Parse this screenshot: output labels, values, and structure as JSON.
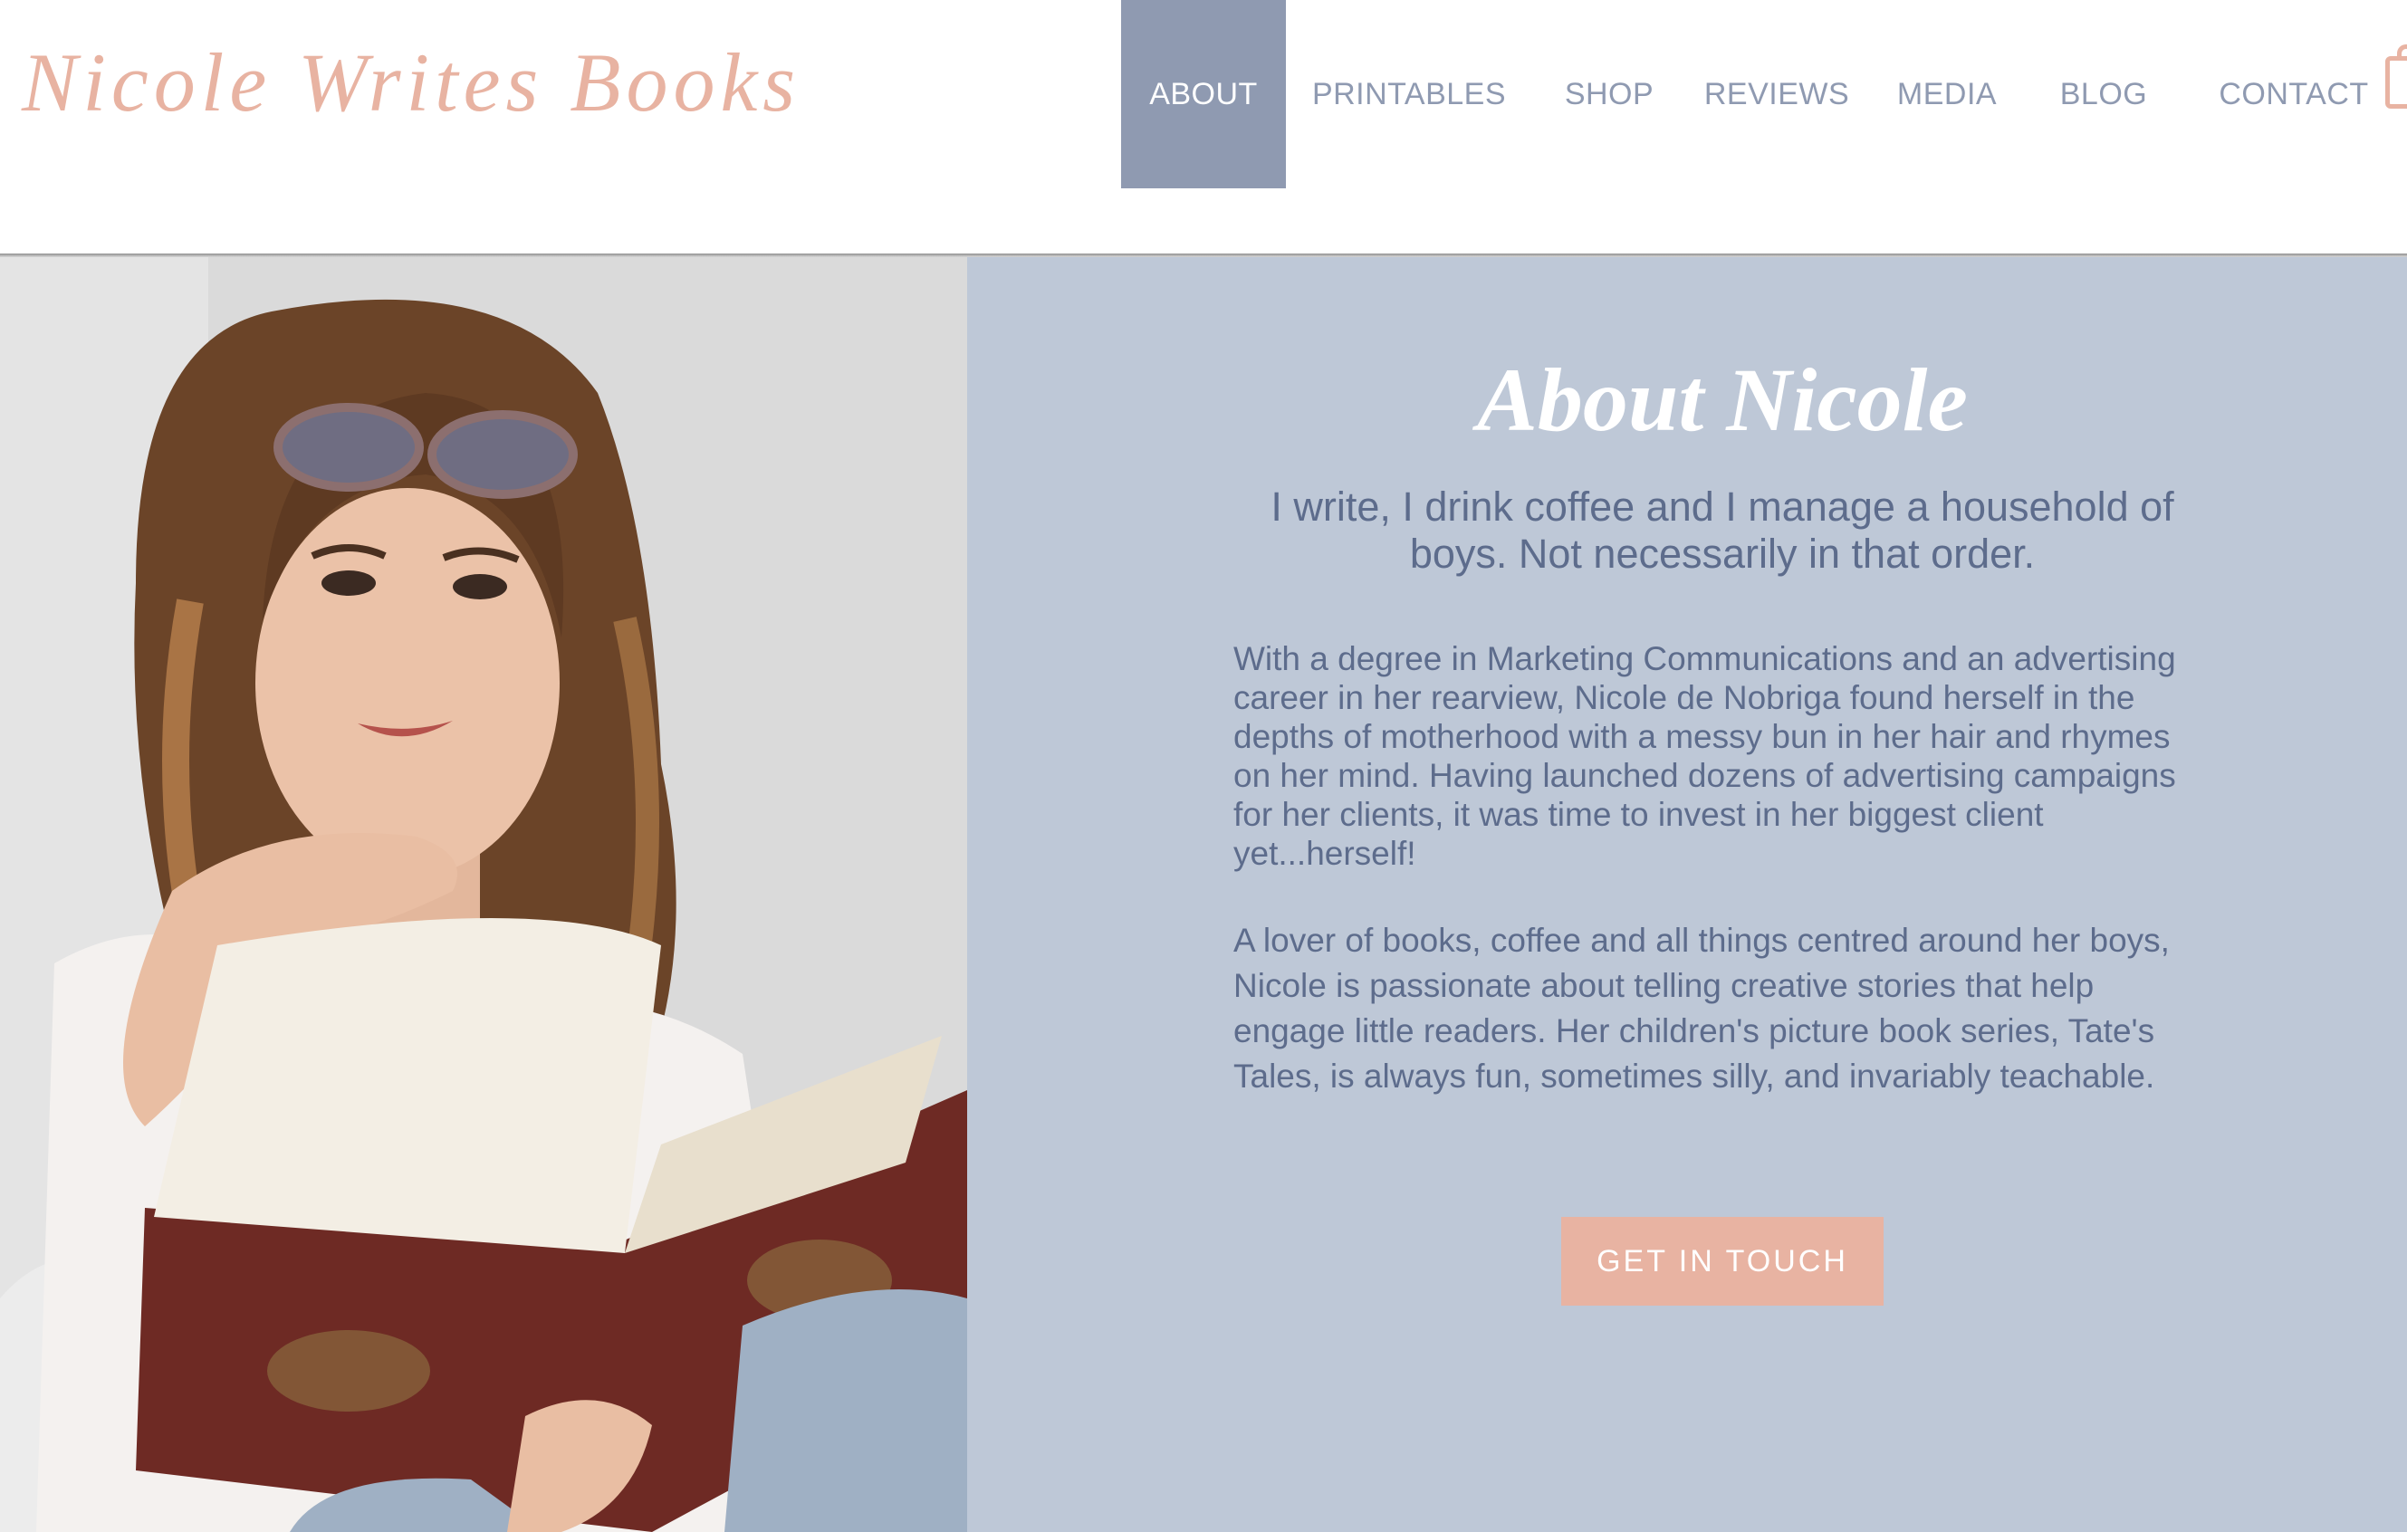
{
  "site": {
    "logo": "Nicole Writes Books"
  },
  "nav": {
    "items": [
      {
        "label": "ABOUT",
        "active": true
      },
      {
        "label": "PRINTABLES"
      },
      {
        "label": "SHOP"
      },
      {
        "label": "REVIEWS"
      },
      {
        "label": "MEDIA"
      },
      {
        "label": "BLOG"
      },
      {
        "label": "CONTACT"
      }
    ],
    "cart_icon": "shopping-bag-icon"
  },
  "about": {
    "title": "About Nicole",
    "tagline": "I write, I drink coffee and I manage a household of boys. Not necessarily in that order.",
    "paragraph1": "With a degree in Marketing Communications and an advertising career in her rearview, Nicole de Nobriga found herself in the depths of motherhood with a messy bun in her hair and rhymes on her mind. Having launched dozens of advertising campaigns for her clients, it was time to invest in her biggest client yet...herself!",
    "paragraph2": "A lover of books, coffee and all things centred around her boys, Nicole is passionate about telling creative stories that help engage little readers. Her children's picture book series, Tate's Tales, is always fun, sometimes silly, and invariably teachable.",
    "cta_label": "GET IN TOUCH"
  },
  "colors": {
    "accent_pink": "#e8b3a2",
    "nav_blue_gray": "#8f9ab1",
    "panel_bg": "#bec8d7",
    "body_text": "#5d6c8c"
  }
}
